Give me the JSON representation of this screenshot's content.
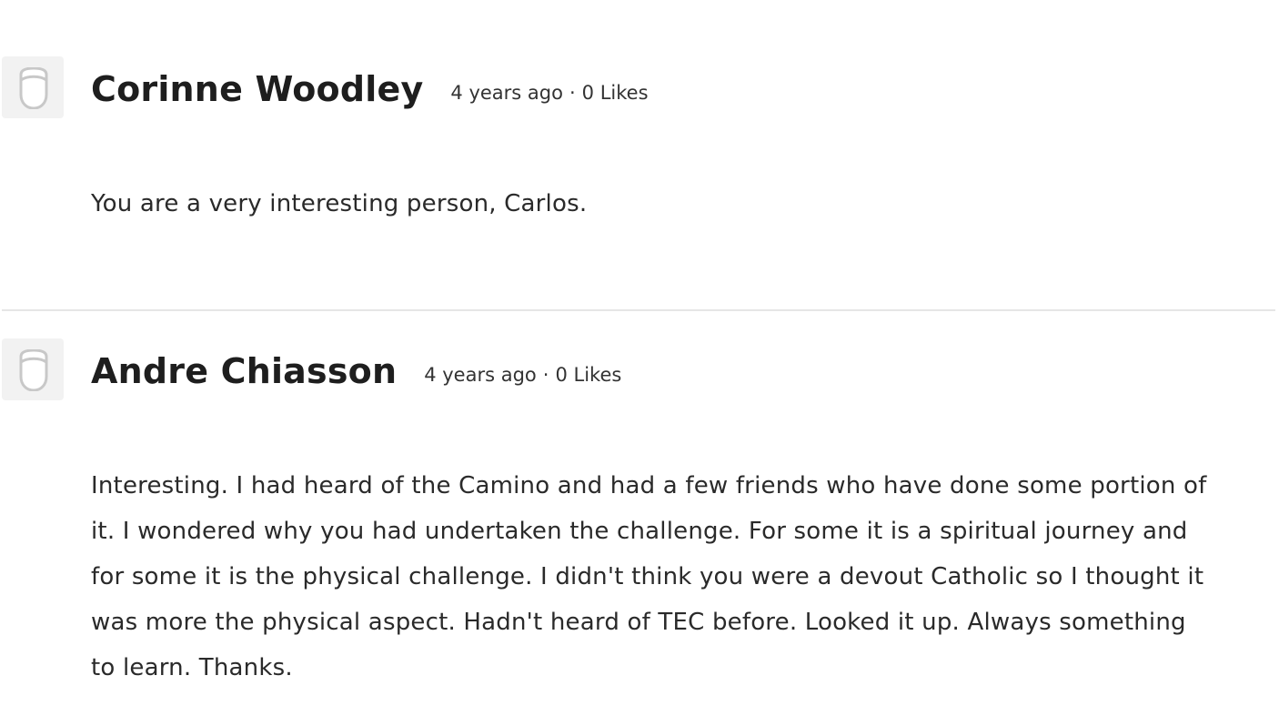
{
  "comments": [
    {
      "author": "Corinne Woodley",
      "time": "4 years ago",
      "separator": "·",
      "likes": "0 Likes",
      "body": "You are a very interesting person, Carlos."
    },
    {
      "author": "Andre Chiasson",
      "time": "4 years ago",
      "separator": "·",
      "likes": "0 Likes",
      "body": "Interesting. I had heard of the Camino and had a few friends who have done some portion of it. I wondered why you had undertaken the challenge. For some it is a spiritual journey and for some it is the physical challenge. I didn't think you were a devout Catholic so I thought it was more the physical aspect. Hadn't heard of TEC before. Looked it up. Always something to learn. Thanks."
    }
  ],
  "colors": {
    "avatar_bg": "#f2f2f2",
    "avatar_icon": "#c8c8c8",
    "divider": "#e6e6e6",
    "text": "#242424"
  },
  "icons": {
    "avatar": "default-avatar-icon"
  }
}
